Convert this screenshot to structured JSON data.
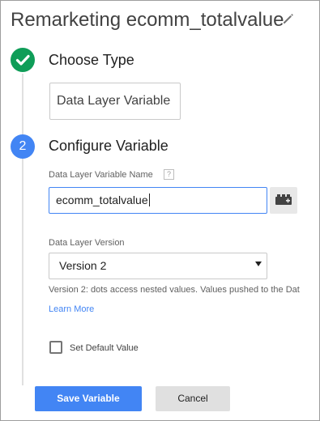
{
  "header": {
    "title": "Remarketing ecomm_totalvalue",
    "edit_icon": "pencil-icon"
  },
  "step1": {
    "title": "Choose Type",
    "status_icon": "checkmark-icon",
    "selected_type": "Data Layer Variable",
    "color": "#0f9d58"
  },
  "step2": {
    "number": "2",
    "title": "Configure Variable",
    "color": "#4285f4"
  },
  "variable_name": {
    "label": "Data Layer Variable Name",
    "help": "?",
    "value": "ecomm_totalvalue",
    "picker_icon": "variable-picker-icon"
  },
  "version": {
    "label": "Data Layer Version",
    "selected": "Version 2",
    "hint": "Version 2: dots access nested values. Values pushed to the Dat",
    "learn_more": "Learn More"
  },
  "default_value": {
    "label": "Set Default Value",
    "checked": false
  },
  "actions": {
    "save": "Save Variable",
    "cancel": "Cancel",
    "accent": "#4285f4"
  }
}
